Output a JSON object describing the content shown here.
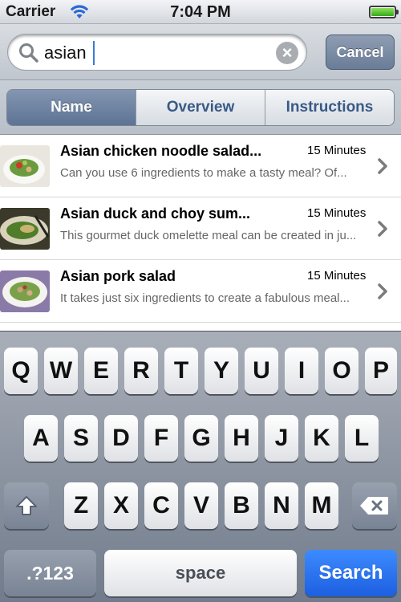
{
  "status_bar": {
    "carrier": "Carrier",
    "time": "7:04 PM"
  },
  "search": {
    "value": "asian",
    "cancel_label": "Cancel"
  },
  "scope": {
    "tabs": [
      "Name",
      "Overview",
      "Instructions"
    ],
    "active": "Name"
  },
  "results": [
    {
      "title": "Asian chicken noodle salad...",
      "time": "15 Minutes",
      "description": "Can you use 6 ingredients to make a tasty meal? Of..."
    },
    {
      "title": "Asian duck and choy sum...",
      "time": "15 Minutes",
      "description": "This gourmet duck omelette meal can be created in ju..."
    },
    {
      "title": "Asian pork salad",
      "time": "15 Minutes",
      "description": "It takes just six ingredients to create a fabulous meal..."
    }
  ],
  "keyboard": {
    "row1": [
      "Q",
      "W",
      "E",
      "R",
      "T",
      "Y",
      "U",
      "I",
      "O",
      "P"
    ],
    "row2": [
      "A",
      "S",
      "D",
      "F",
      "G",
      "H",
      "J",
      "K",
      "L"
    ],
    "row3": [
      "Z",
      "X",
      "C",
      "V",
      "B",
      "N",
      "M"
    ],
    "numbers_label": ".?123",
    "space_label": "space",
    "search_label": "Search"
  },
  "colors": {
    "accent": "#1d5fe0",
    "active_segment": "#5d7394"
  }
}
